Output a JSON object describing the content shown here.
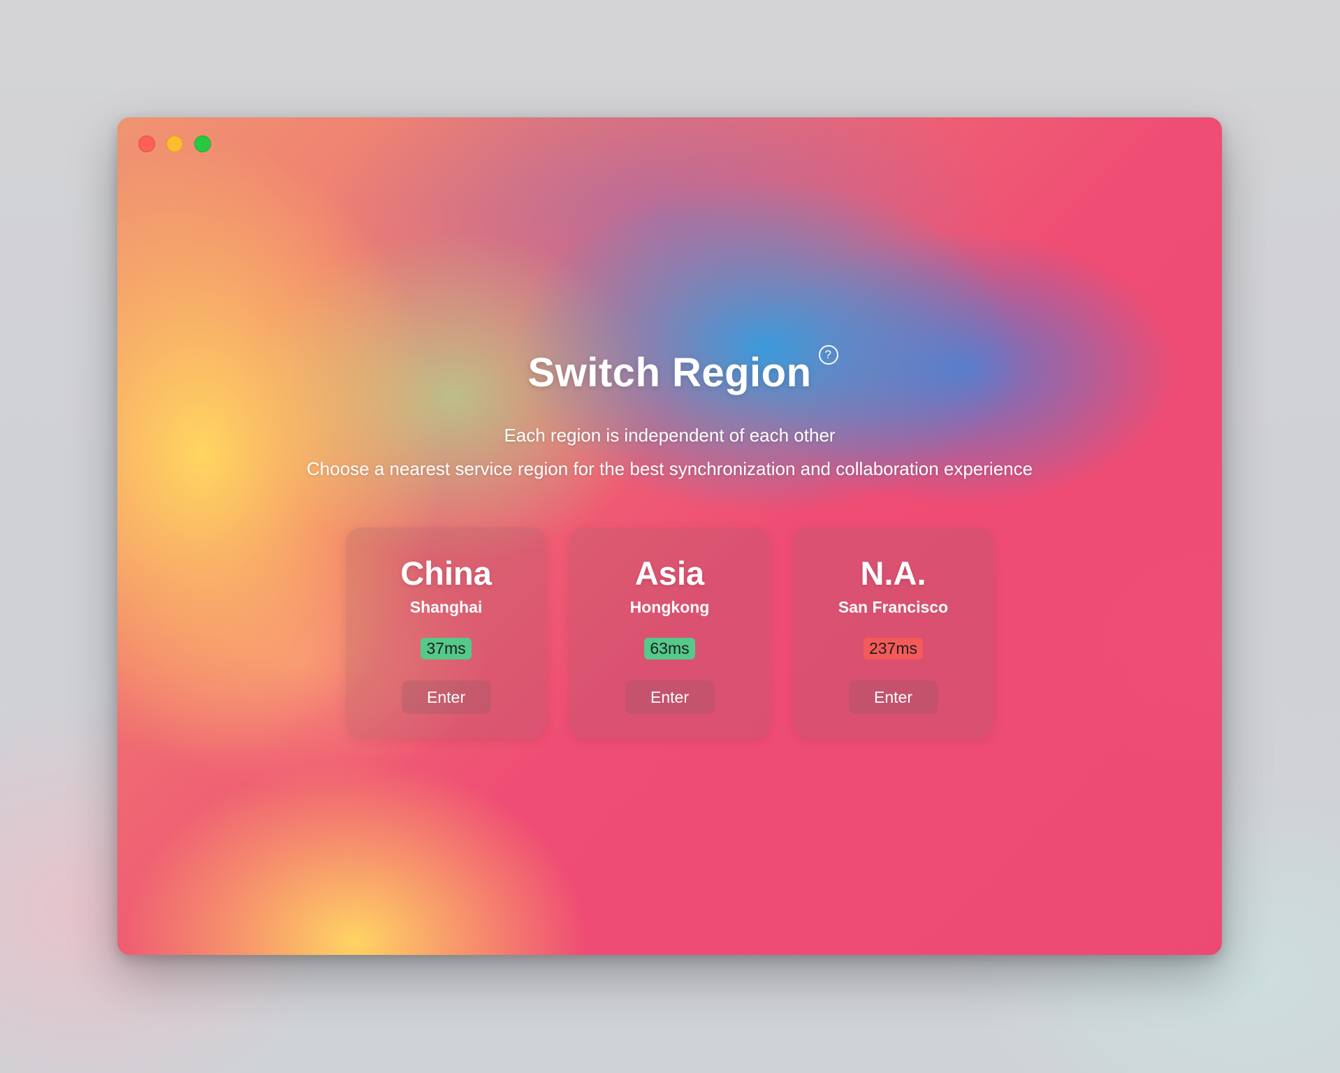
{
  "window": {
    "buttons": [
      "close",
      "minimize",
      "zoom"
    ]
  },
  "header": {
    "title": "Switch Region",
    "help_icon": "question-circle-icon",
    "help_glyph": "?",
    "subtitle_1": "Each region is independent of each other",
    "subtitle_2": "Choose a nearest service region for the best synchronization and collaboration experience"
  },
  "regions": [
    {
      "name": "China",
      "city": "Shanghai",
      "latency": "37ms",
      "status": "good",
      "enter_label": "Enter"
    },
    {
      "name": "Asia",
      "city": "Hongkong",
      "latency": "63ms",
      "status": "good",
      "enter_label": "Enter"
    },
    {
      "name": "N.A.",
      "city": "San Francisco",
      "latency": "237ms",
      "status": "bad",
      "enter_label": "Enter"
    }
  ],
  "colors": {
    "latency_good": "#54c98a",
    "latency_bad": "#f55a5a",
    "traffic_red": "#fe5f57",
    "traffic_yellow": "#febc2e",
    "traffic_green": "#28c840"
  }
}
